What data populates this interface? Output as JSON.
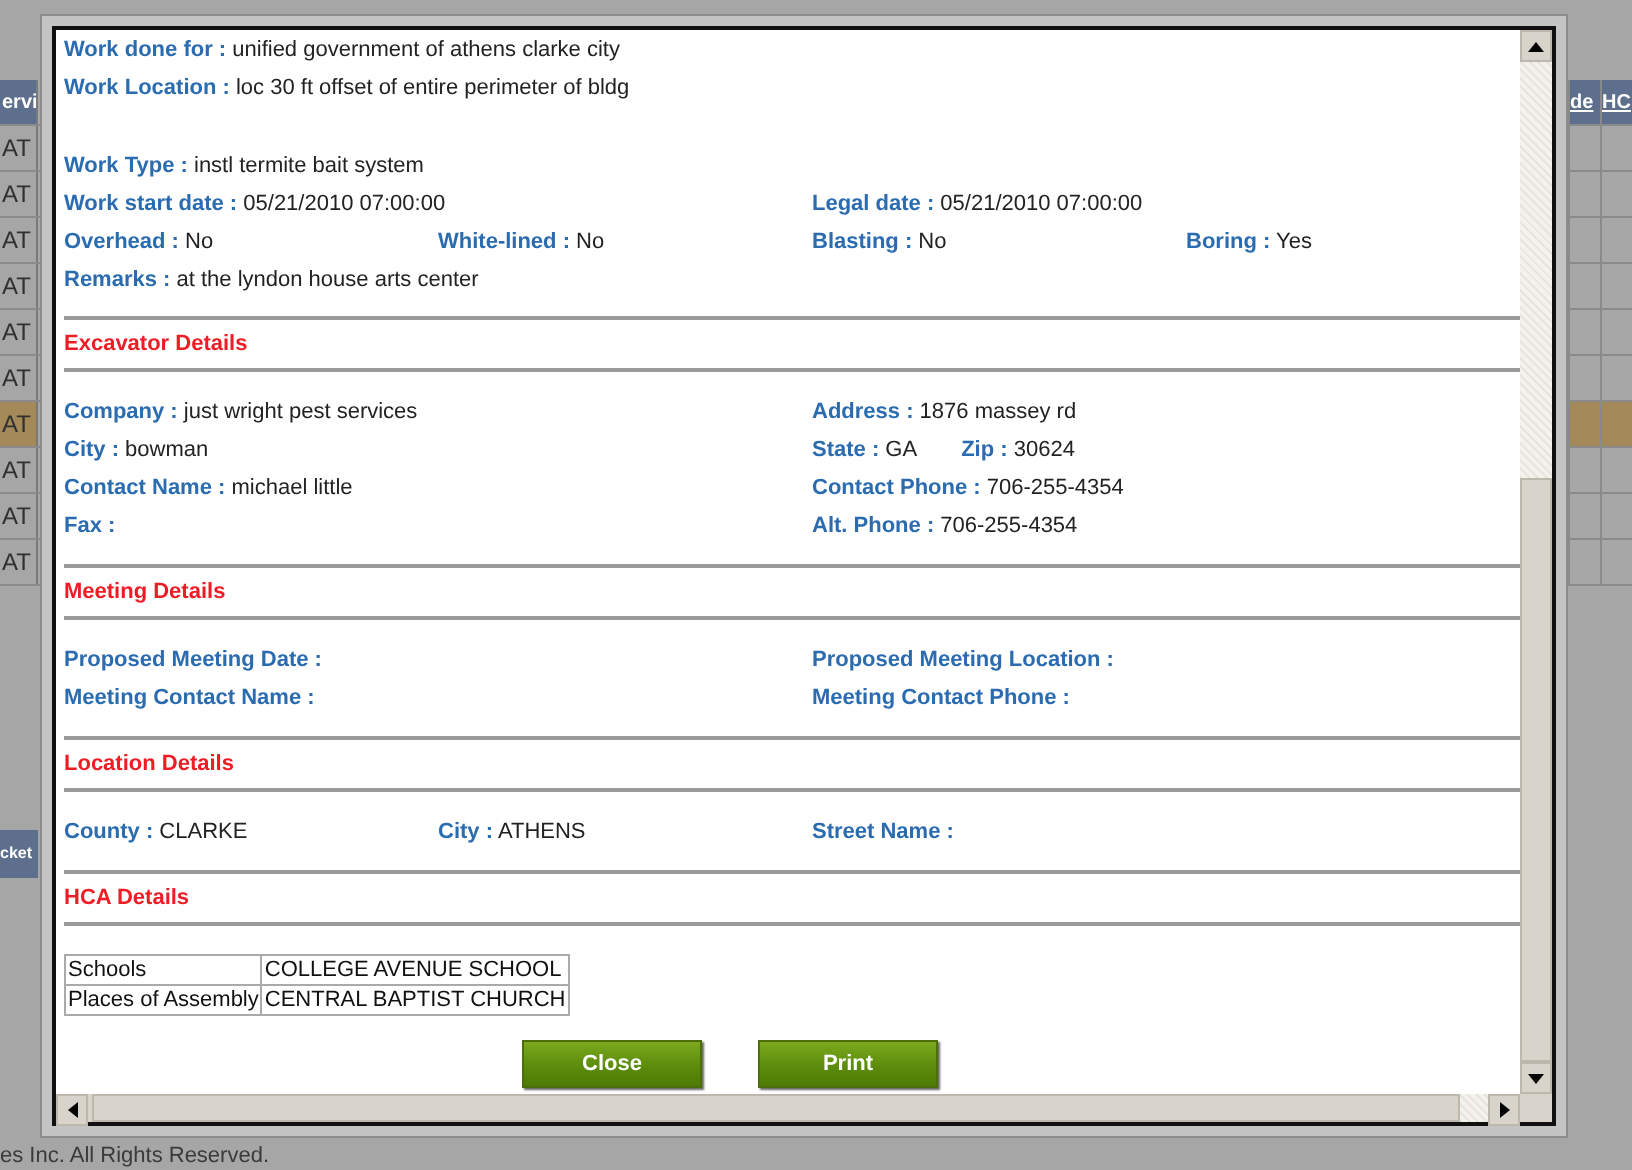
{
  "background": {
    "grid": {
      "columns": [
        "ervi",
        "de",
        "HC"
      ],
      "rows": [
        {
          "cell": "AT",
          "selected": false
        },
        {
          "cell": "AT",
          "selected": false
        },
        {
          "cell": "AT",
          "selected": false
        },
        {
          "cell": "AT",
          "selected": false
        },
        {
          "cell": "AT",
          "selected": false
        },
        {
          "cell": "AT",
          "selected": false
        },
        {
          "cell": "AT",
          "selected": true
        },
        {
          "cell": "AT",
          "selected": false
        },
        {
          "cell": "AT",
          "selected": false
        },
        {
          "cell": "AT",
          "selected": false
        }
      ]
    },
    "bar": "cket",
    "footer": "es Inc. All Rights Reserved."
  },
  "dialog": {
    "sections": [
      {
        "rows": [
          {
            "kind": "full",
            "field": {
              "label": "Work done for :",
              "value": "unified government of athens clarke city"
            }
          },
          {
            "kind": "full",
            "field": {
              "label": "Work Location :",
              "value": "loc 30 ft offset of entire perimeter of bldg"
            }
          },
          {
            "kind": "full",
            "spaced": true,
            "field": {
              "label": "Work Type :",
              "value": "instl termite bait system"
            }
          },
          {
            "kind": "pair",
            "left": [
              {
                "label": "Work start date :",
                "value": "05/21/2010 07:00:00"
              }
            ],
            "right": [
              {
                "label": "Legal date :",
                "value": "05/21/2010 07:00:00"
              }
            ]
          },
          {
            "kind": "quad",
            "items": [
              {
                "label": "Overhead :",
                "value": "No"
              },
              {
                "label": "White-lined :",
                "value": "No"
              },
              {
                "label": "Blasting :",
                "value": "No"
              },
              {
                "label": "Boring :",
                "value": "Yes"
              }
            ]
          },
          {
            "kind": "full",
            "field": {
              "label": "Remarks :",
              "value": "at the lyndon house arts center"
            }
          }
        ]
      },
      {
        "title": "Excavator Details",
        "rows": [
          {
            "kind": "pair",
            "left": [
              {
                "label": "Company :",
                "value": "just wright pest services"
              }
            ],
            "right": [
              {
                "label": "Address :",
                "value": "1876 massey rd"
              }
            ]
          },
          {
            "kind": "pair",
            "left": [
              {
                "label": "City :",
                "value": "bowman"
              }
            ],
            "right": [
              {
                "label": "State :",
                "value": "GA"
              },
              {
                "label": "Zip :",
                "value": "30624"
              }
            ]
          },
          {
            "kind": "pair",
            "left": [
              {
                "label": "Contact Name :",
                "value": "michael little"
              }
            ],
            "right": [
              {
                "label": "Contact Phone :",
                "value": "706-255-4354"
              }
            ]
          },
          {
            "kind": "pair",
            "left": [
              {
                "label": "Fax :"
              }
            ],
            "right": [
              {
                "label": "Alt. Phone :",
                "value": "706-255-4354"
              }
            ]
          }
        ]
      },
      {
        "title": "Meeting Details",
        "rows": [
          {
            "kind": "pair",
            "left": [
              {
                "label": "Proposed Meeting Date :"
              }
            ],
            "right": [
              {
                "label": "Proposed Meeting Location :"
              }
            ]
          },
          {
            "kind": "pair",
            "left": [
              {
                "label": "Meeting Contact Name :"
              }
            ],
            "right": [
              {
                "label": "Meeting Contact Phone :"
              }
            ]
          }
        ]
      },
      {
        "title": "Location Details",
        "rows": [
          {
            "kind": "quad",
            "items": [
              {
                "label": "County :",
                "value": "CLARKE"
              },
              {
                "label": "City :",
                "value": "ATHENS"
              },
              {
                "label": "Street Name :"
              }
            ]
          }
        ]
      },
      {
        "title": "HCA Details",
        "table": [
          [
            "Schools",
            "COLLEGE AVENUE SCHOOL"
          ],
          [
            "Places of Assembly",
            "CENTRAL BAPTIST CHURCH"
          ]
        ]
      }
    ],
    "buttons": [
      "Close",
      "Print"
    ]
  }
}
